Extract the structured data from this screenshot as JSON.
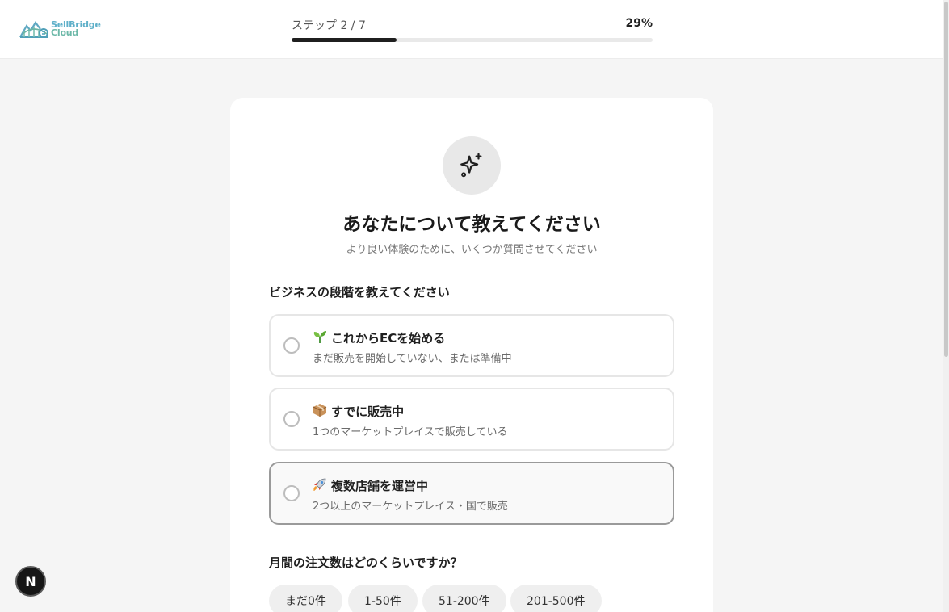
{
  "brand": {
    "line1": "SellBridge",
    "line2": "Cloud"
  },
  "progress": {
    "step_label": "ステップ 2 / 7",
    "percent_label": "29%",
    "fraction": 0.29
  },
  "card": {
    "icon": "sparkles-icon",
    "title": "あなたについて教えてください",
    "subtitle": "より良い体験のために、いくつか質問させてください"
  },
  "business_stage": {
    "label": "ビジネスの段階を教えてください",
    "options": [
      {
        "emoji": "seedling",
        "title": "これからECを始める",
        "desc": "まだ販売を開始していない、または準備中"
      },
      {
        "emoji": "package",
        "title": "すでに販売中",
        "desc": "1つのマーケットプレイスで販売している"
      },
      {
        "emoji": "rocket",
        "title": "複数店舗を運営中",
        "desc": "2つ以上のマーケットプレイス・国で販売"
      }
    ]
  },
  "monthly_orders": {
    "label": "月間の注文数はどのくらいですか？",
    "options": [
      "まだ0件",
      "1-50件",
      "51-200件",
      "201-500件"
    ]
  },
  "dev_badge": "N"
}
